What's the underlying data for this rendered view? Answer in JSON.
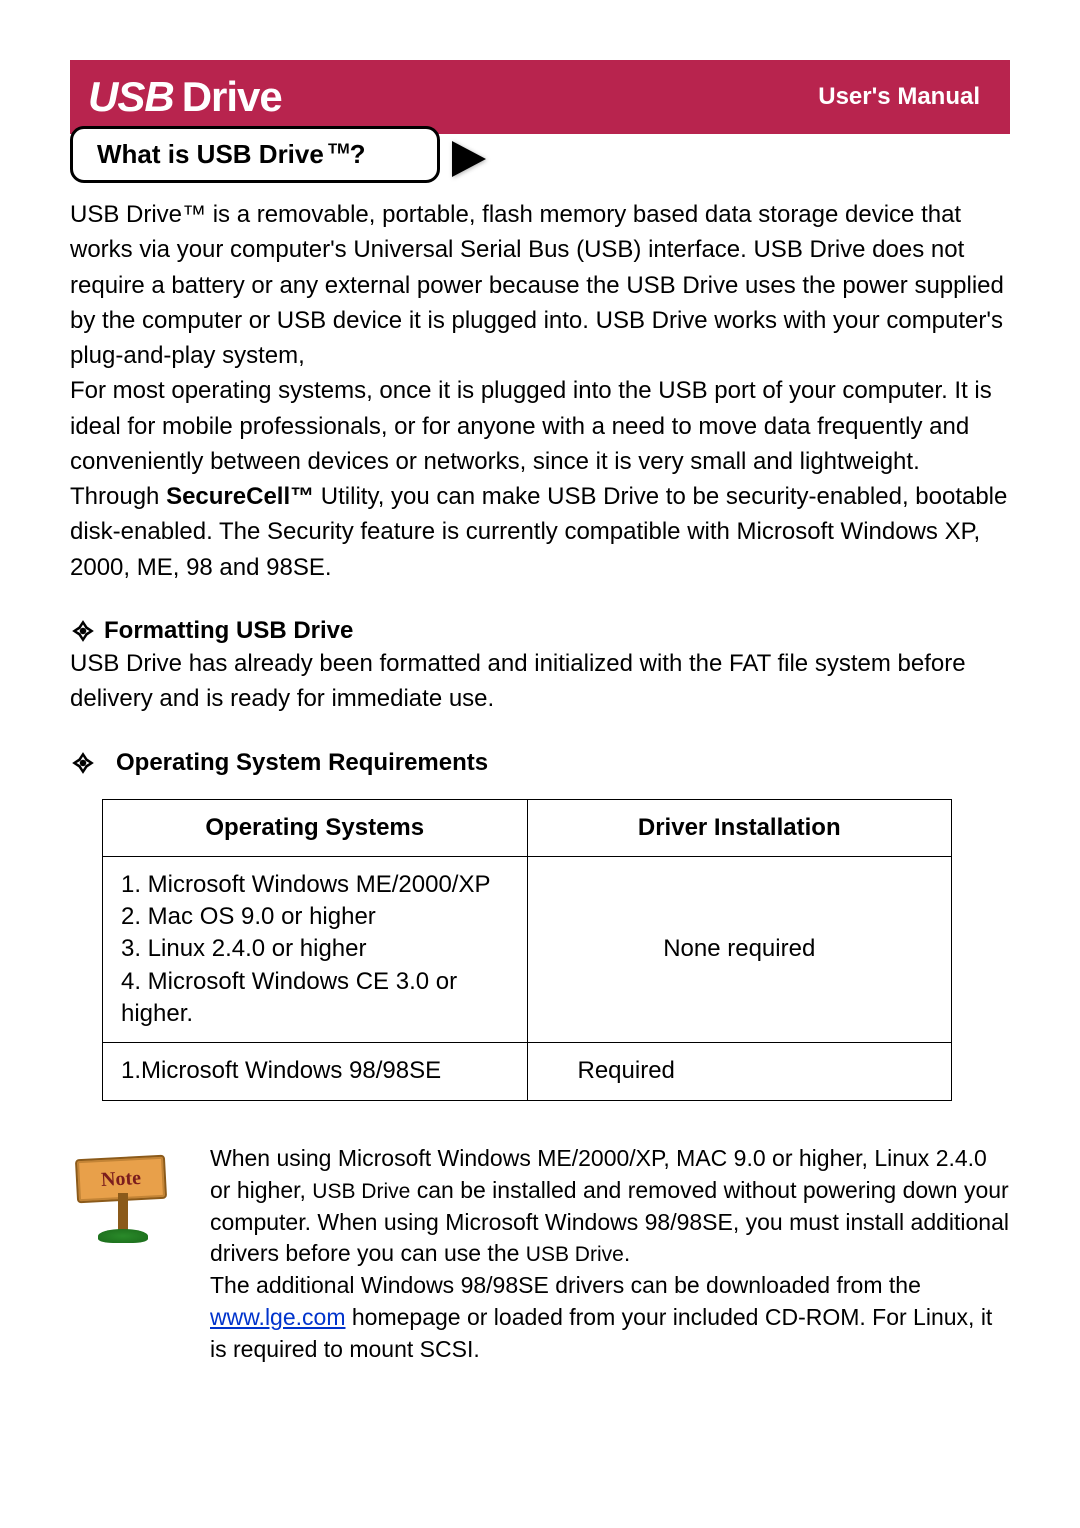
{
  "header": {
    "logo_usb": "USB",
    "logo_drive": "Drive",
    "users_manual": "User's Manual"
  },
  "section_title": {
    "text_prefix": "What is USB Drive",
    "tm": " TM",
    "text_suffix": "?"
  },
  "intro": {
    "p1_part1": "USB Drive™ is a removable, portable, flash memory based data storage device that works via your computer's Universal Serial Bus (USB) interface. USB Drive does not require a battery or any external power because the USB Drive uses the power supplied by the computer or USB device it is plugged into. USB Drive works with your computer's plug-and-play system,",
    "p1_part2": "For most operating systems, once it is plugged into the USB port of your computer. It is ideal for mobile professionals, or for anyone with a need to move data frequently and conveniently between devices or networks, since it is very small and lightweight. Through ",
    "securecell": "SecureCell™",
    "p1_part3": " Utility, you can make USB Drive to be security-enabled, bootable disk-enabled.    The Security feature is currently compatible with Microsoft Windows XP, 2000, ME, 98 and 98SE."
  },
  "formatting": {
    "title": "Formatting USB Drive",
    "body": "USB Drive has already been formatted and initialized with the FAT file system before delivery and is ready for immediate use."
  },
  "os_req": {
    "title": "Operating System Requirements",
    "table": {
      "headers": {
        "col1": "Operating Systems",
        "col2": "Driver Installation"
      },
      "rows": [
        {
          "os_lines": [
            "1. Microsoft Windows ME/2000/XP",
            "2. Mac OS 9.0 or higher",
            "3. Linux 2.4.0 or higher",
            "4. Microsoft Windows CE 3.0 or higher."
          ],
          "driver": "None required"
        },
        {
          "os_lines": [
            "1.Microsoft Windows 98/98SE"
          ],
          "driver": "Required"
        }
      ]
    }
  },
  "note": {
    "label": "Note",
    "text_part1": "When using Microsoft Windows ME/2000/XP, MAC 9.0 or higher, Linux 2.4.0 or higher, ",
    "usb_drive_1": "USB Drive",
    "text_part2": " can be installed and removed without powering down your computer. When using Microsoft Windows 98/98SE, you must install additional drivers before you can use the ",
    "usb_drive_2": "USB Drive",
    "text_part3": ".",
    "text_part4": "The additional Windows 98/98SE drivers can be downloaded from the ",
    "link": "www.lge.com",
    "text_part5": "   homepage or loaded from your included CD-ROM. For Linux, it is required to mount SCSI."
  }
}
